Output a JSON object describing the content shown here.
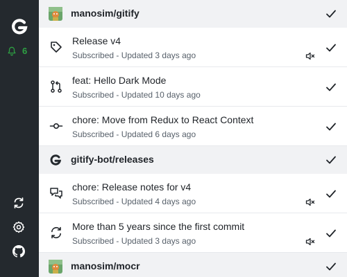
{
  "sidebar": {
    "logo_icon": "gitify-logo-icon",
    "notification_icon": "bell-icon",
    "notification_count": "6",
    "bottom_icons": [
      "refresh-icon",
      "gear-icon",
      "github-icon"
    ],
    "accent_color": "#2ea043",
    "background": "#24292e"
  },
  "groups": [
    {
      "repo": "manosim/gitify",
      "avatar_icon": "repo-avatar-image",
      "notifications": [
        {
          "title": "Release v4",
          "meta": "Subscribed - Updated 3 days ago",
          "type_icon": "tag-icon"
        },
        {
          "title": "feat: Hello Dark Mode",
          "meta": "Subscribed - Updated 10 days ago",
          "type_icon": "pull-request-icon"
        },
        {
          "title": "chore: Move from Redux to React Context",
          "meta": "Subscribed - Updated 6 days ago",
          "type_icon": "commit-icon"
        }
      ]
    },
    {
      "repo": "gitify-bot/releases",
      "avatar_icon": "gitify-logo-icon",
      "notifications": [
        {
          "title": "chore: Release notes for v4",
          "meta": "Subscribed - Updated 4 days ago",
          "type_icon": "discussion-icon"
        },
        {
          "title": "More than 5 years since the first commit",
          "meta": "Subscribed - Updated 3 days ago",
          "type_icon": "sync-icon"
        }
      ]
    },
    {
      "repo": "manosim/mocr",
      "avatar_icon": "repo-avatar-image",
      "notifications": []
    }
  ]
}
